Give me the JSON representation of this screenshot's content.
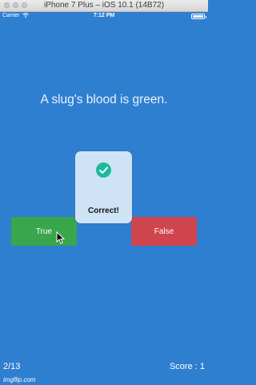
{
  "window": {
    "title": "iPhone 7 Plus – iOS 10.1 (14B72)"
  },
  "status_bar": {
    "carrier": "Carrier",
    "time": "7:12 PM"
  },
  "question": {
    "text": "A slug's blood is green."
  },
  "buttons": {
    "true_label": "True",
    "false_label": "False"
  },
  "popup": {
    "message": "Correct!"
  },
  "footer": {
    "progress": "2/13",
    "score": "Score : 1"
  },
  "watermark": "imgflip.com",
  "colors": {
    "background": "#2f7fd0",
    "true_button": "#3aa64c",
    "false_button": "#cf444d",
    "popup": "#cfe3f7",
    "check": "#1fb89c"
  }
}
